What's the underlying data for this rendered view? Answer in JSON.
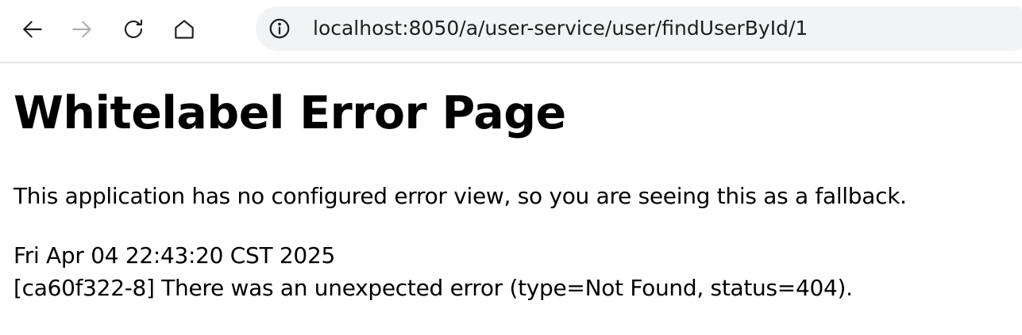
{
  "browser": {
    "address_bar": {
      "url": "localhost:8050/a/user-service/user/findUserById/1"
    },
    "icons": {
      "back": "arrow-left-icon",
      "forward": "arrow-right-icon",
      "reload": "reload-icon",
      "home": "home-icon",
      "site_info": "info-icon"
    },
    "colors": {
      "toolbar_bg": "#ffffff",
      "omnibox_bg": "#f1f3f4",
      "icon_active": "#1f1f1f",
      "icon_disabled": "#b0b0b0"
    }
  },
  "page": {
    "heading": "Whitelabel Error Page",
    "message": "This application has no configured error view, so you are seeing this as a fallback.",
    "timestamp": "Fri Apr 04 22:43:20 CST 2025",
    "error_detail": "[ca60f322-8] There was an unexpected error (type=Not Found, status=404)."
  }
}
